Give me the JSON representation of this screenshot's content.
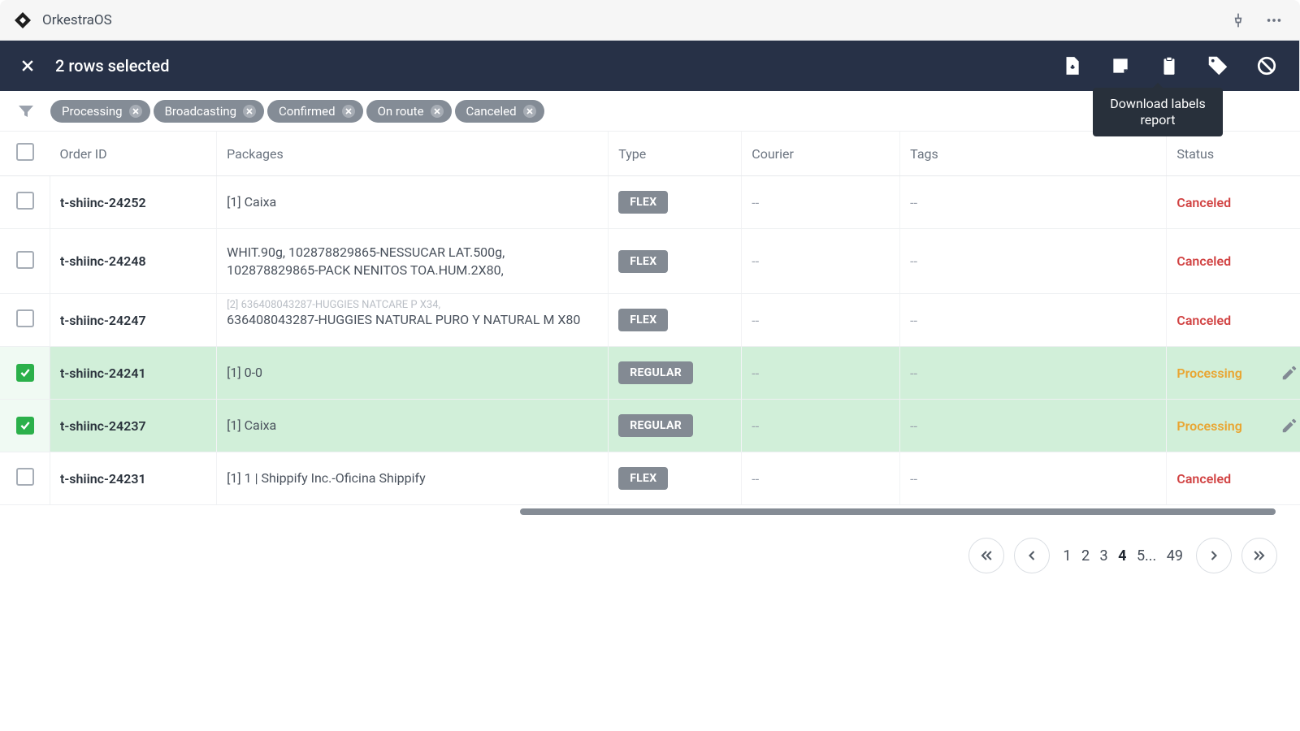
{
  "app": {
    "name": "OrkestraOS"
  },
  "selection": {
    "count_text": "2 rows selected",
    "tooltip": "Download labels report"
  },
  "filters": [
    {
      "label": "Processing"
    },
    {
      "label": "Broadcasting"
    },
    {
      "label": "Confirmed"
    },
    {
      "label": "On route"
    },
    {
      "label": "Canceled"
    }
  ],
  "columns": {
    "order_id": "Order ID",
    "packages": "Packages",
    "type": "Type",
    "courier": "Courier",
    "tags": "Tags",
    "status": "Status"
  },
  "rows": [
    {
      "selected": false,
      "order_id": "t-shiinc-24252",
      "packages": "[1] Caixa",
      "type": "FLEX",
      "courier": "--",
      "tags": "--",
      "status": "Canceled",
      "status_class": "status-canceled"
    },
    {
      "selected": false,
      "order_id": "t-shiinc-24248",
      "packages": "WHIT.90g, 102878829865-NESSUCAR LAT.500g, 102878829865-PACK NENITOS TOA.HUM.2X80,",
      "type": "FLEX",
      "courier": "--",
      "tags": "--",
      "status": "Canceled",
      "status_class": "status-canceled"
    },
    {
      "selected": false,
      "order_id": "t-shiinc-24247",
      "packages_pre": "[2] 636408043287-HUGGIES NATCARE P X34,",
      "packages": "636408043287-HUGGIES NATURAL PURO Y NATURAL M X80",
      "type": "FLEX",
      "courier": "--",
      "tags": "--",
      "status": "Canceled",
      "status_class": "status-canceled"
    },
    {
      "selected": true,
      "order_id": "t-shiinc-24241",
      "packages": "[1] 0-0",
      "type": "REGULAR",
      "courier": "--",
      "tags": "--",
      "status": "Processing",
      "status_class": "status-processing"
    },
    {
      "selected": true,
      "order_id": "t-shiinc-24237",
      "packages": "[1] Caixa",
      "type": "REGULAR",
      "courier": "--",
      "tags": "--",
      "status": "Processing",
      "status_class": "status-processing"
    },
    {
      "selected": false,
      "order_id": "t-shiinc-24231",
      "packages": "[1] 1 | Shippify Inc.-Oficina Shippify",
      "type": "FLEX",
      "courier": "--",
      "tags": "--",
      "status": "Canceled",
      "status_class": "status-canceled"
    }
  ],
  "pagination": {
    "pages": [
      "1",
      "2",
      "3",
      "4",
      "5...",
      "49"
    ],
    "current": "4"
  }
}
